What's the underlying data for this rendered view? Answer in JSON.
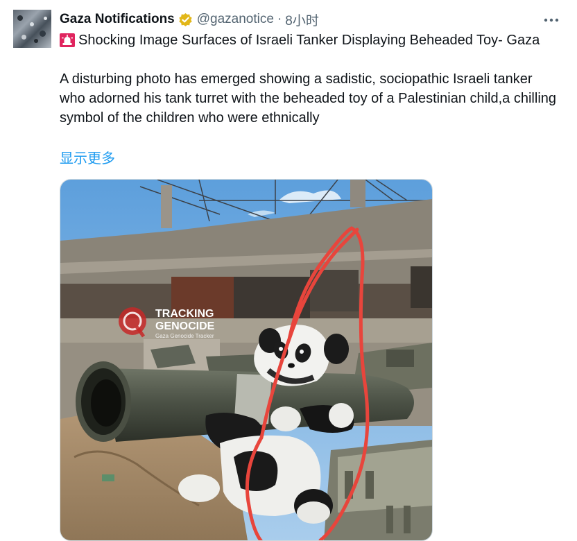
{
  "tweet": {
    "author_name": "Gaza Notifications",
    "handle": "@gazanotice",
    "separator": "·",
    "timestamp": "8小时",
    "headline": "Shocking Image Surfaces of Israeli Tanker Displaying Beheaded Toy- Gaza",
    "body": "A disturbing photo has emerged showing a sadistic, sociopathic Israeli tanker who adorned his tank turret with the beheaded toy of a Palestinian child,a chilling symbol of the children who were ethnically",
    "show_more": "显示更多"
  },
  "media": {
    "watermark_line1": "TRACKING",
    "watermark_line2": "GENOCIDE",
    "watermark_sub": "Gaza Genocide Tracker"
  },
  "icons": {
    "verified": "verified-gold-badge-icon",
    "headline": "rotating-light-siren-icon",
    "more": "more-options-dots-icon"
  },
  "colors": {
    "link": "#1d9bf0",
    "secondary_text": "#536471",
    "verified_badge": "#e2b719",
    "siren": "#e0245e",
    "highlight_circle": "#e8453c"
  }
}
